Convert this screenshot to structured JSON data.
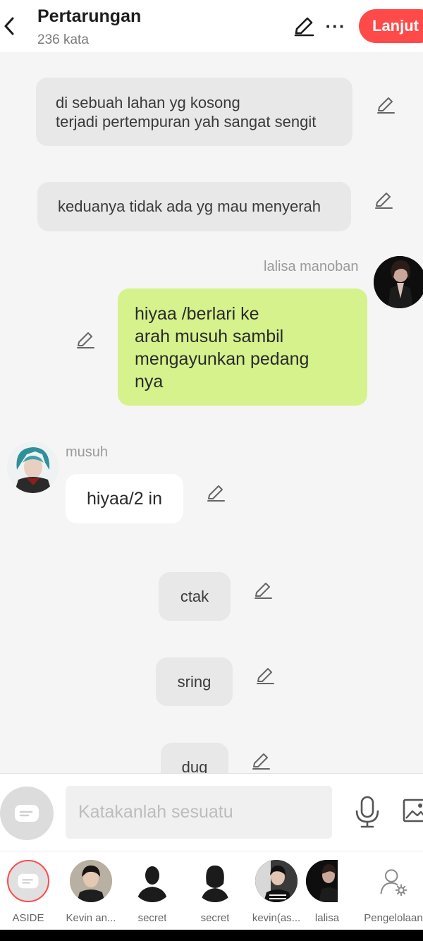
{
  "header": {
    "title": "Pertarungan",
    "subtitle": "236 kata",
    "next_label": "Lanjut"
  },
  "messages": {
    "narration_1": {
      "line1": "di sebuah lahan yg kosong",
      "line2": "terjadi pertempuran yah sangat sengit"
    },
    "narration_2": "keduanya tidak ada yg mau menyerah",
    "speaker_1": {
      "name": "lalisa manoban",
      "text_lines": [
        "hiyaa /berlari ke",
        "arah musuh sambil",
        "mengayunkan pedang",
        "nya"
      ]
    },
    "speaker_2": {
      "name": "musuh",
      "text": "hiyaa/2 in"
    },
    "narration_3": "ctak",
    "narration_4": "sring",
    "narration_5": "dug"
  },
  "input": {
    "placeholder": "Katakanlah sesuatu"
  },
  "characters": [
    {
      "label": "ASIDE",
      "icon": "aside-icon"
    },
    {
      "label": "Kevin an...",
      "icon": "avatar"
    },
    {
      "label": "secret",
      "icon": "silhouette-male"
    },
    {
      "label": "secret",
      "icon": "silhouette-female"
    },
    {
      "label": "kevin(as...",
      "icon": "avatar"
    },
    {
      "label": "lalisa",
      "icon": "avatar"
    },
    {
      "label": "Pengelolaan",
      "icon": "person-settings-icon"
    }
  ],
  "colors": {
    "accent": "#ff4a4a",
    "player_bubble": "#d6f28c",
    "narration_bg": "#e8e8e8"
  }
}
